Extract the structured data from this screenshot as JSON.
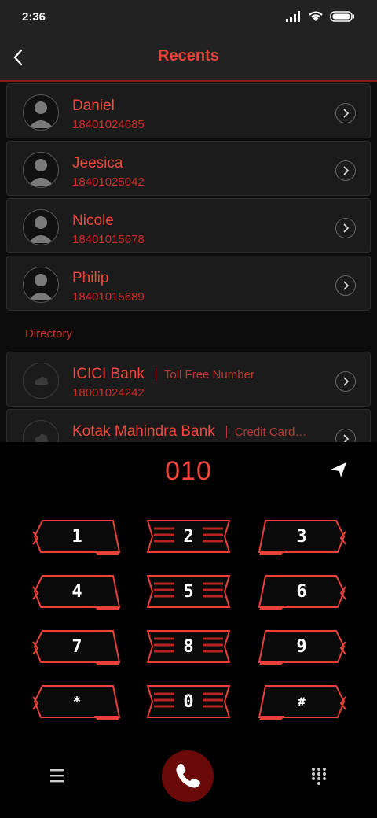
{
  "status": {
    "time": "2:36"
  },
  "header": {
    "title": "Recents"
  },
  "recents": [
    {
      "name": "Daniel",
      "number": "18401024685"
    },
    {
      "name": "Jeesica",
      "number": "18401025042"
    },
    {
      "name": "Nicole",
      "number": "18401015678"
    },
    {
      "name": "Philip",
      "number": "18401015689"
    }
  ],
  "directory": {
    "label": "Directory",
    "items": [
      {
        "name": "ICICI Bank",
        "tag": "Toll Free Number",
        "number": "18001024242"
      },
      {
        "name": "Kotak Mahindra Bank",
        "tag": "Credit Card…",
        "number": ""
      }
    ]
  },
  "dialer": {
    "input": "010",
    "keys": [
      "1",
      "2",
      "3",
      "4",
      "5",
      "6",
      "7",
      "8",
      "9",
      "*",
      "0",
      "#"
    ]
  },
  "colors": {
    "accent": "#e8403a",
    "dark_red": "#6a0a08",
    "bg": "#0c0c0c"
  }
}
